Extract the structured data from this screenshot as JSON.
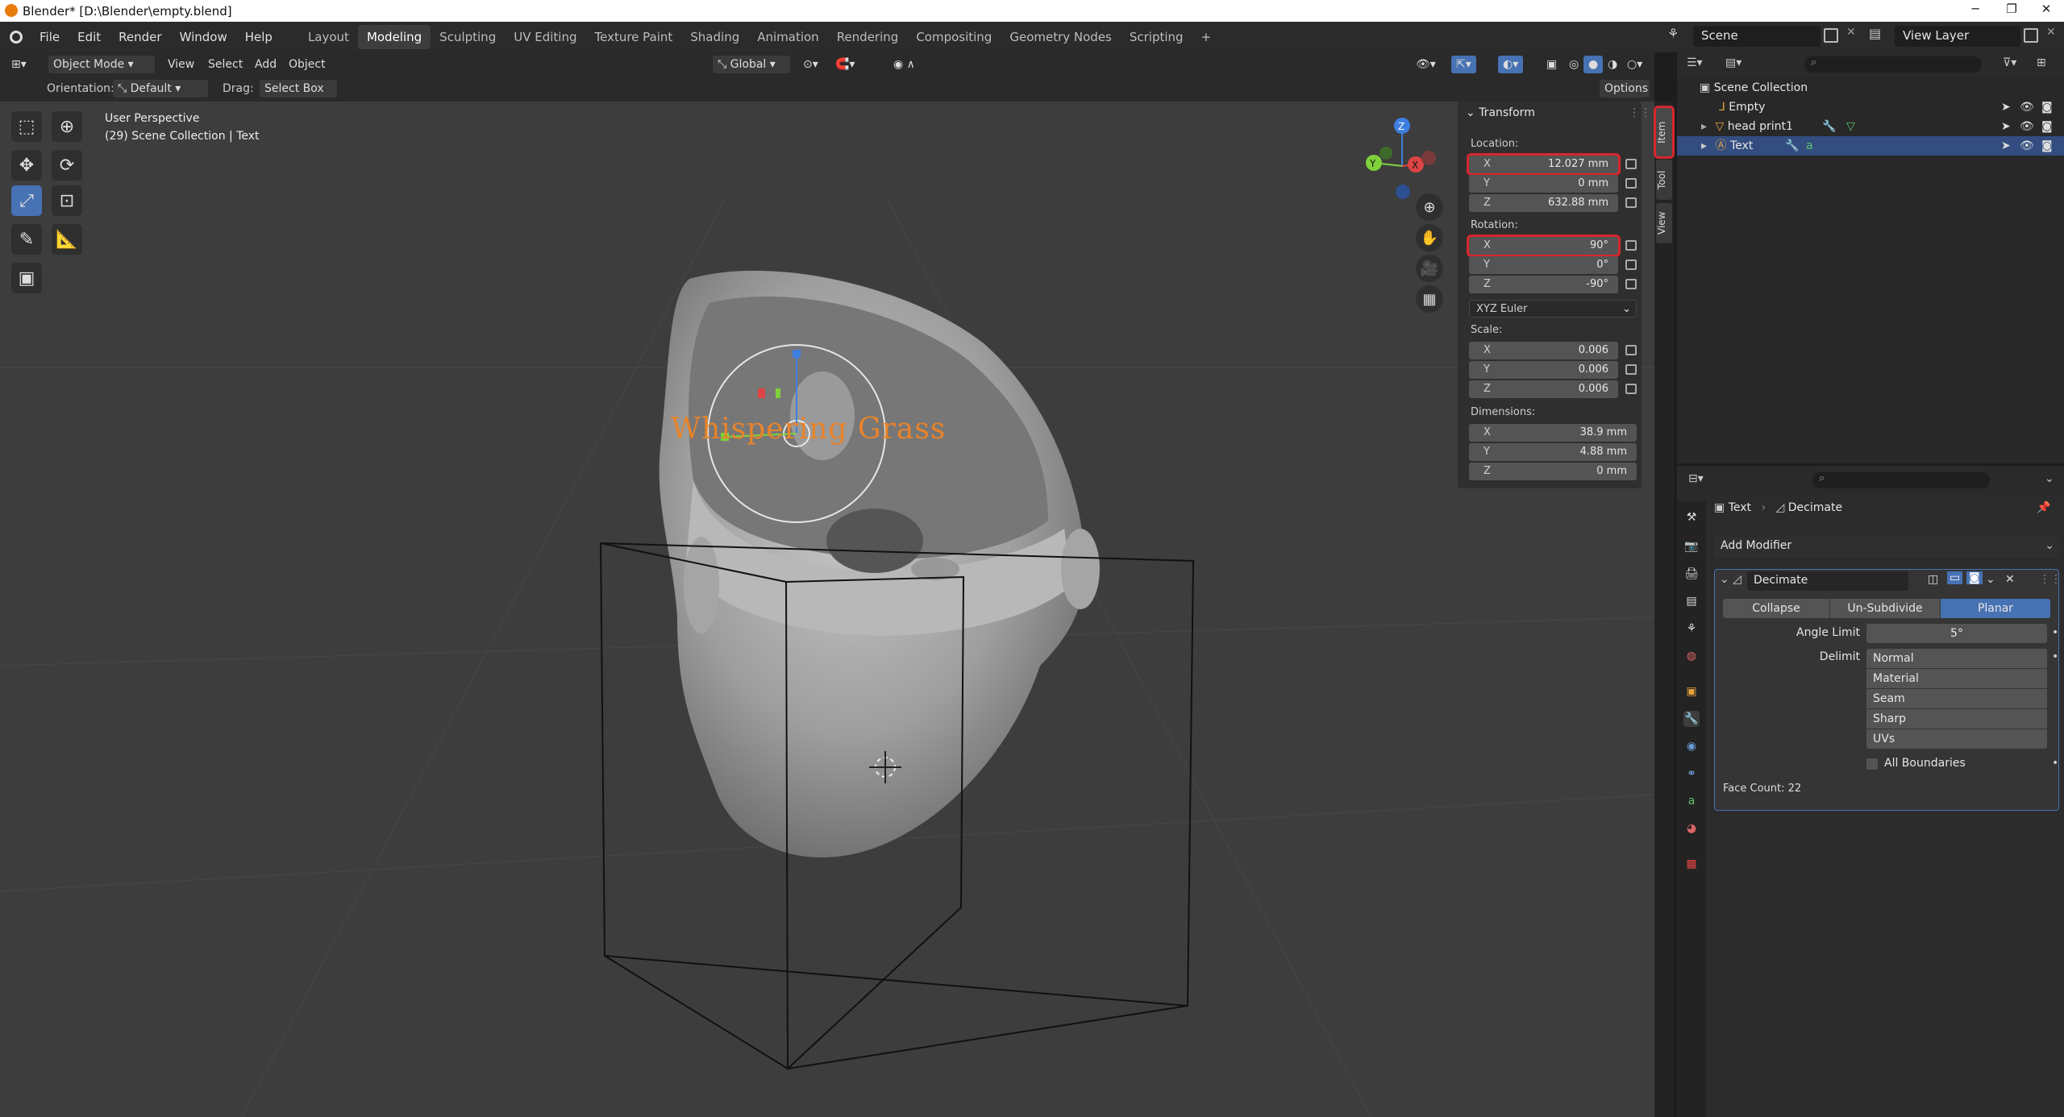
{
  "title_bar": {
    "title": "Blender* [D:\\Blender\\empty.blend]"
  },
  "menu": [
    "File",
    "Edit",
    "Render",
    "Window",
    "Help"
  ],
  "workspaces": [
    "Layout",
    "Modeling",
    "Sculpting",
    "UV Editing",
    "Texture Paint",
    "Shading",
    "Animation",
    "Rendering",
    "Compositing",
    "Geometry Nodes",
    "Scripting",
    "+"
  ],
  "active_workspace": "Modeling",
  "scene": {
    "scene_label": "Scene",
    "view_layer_label": "View Layer"
  },
  "viewport_header": {
    "mode": "Object Mode",
    "view": "View",
    "select": "Select",
    "add": "Add",
    "object": "Object",
    "transform_space": "Global",
    "orientation_label": "Orientation:",
    "orientation_value": "Default",
    "drag_label": "Drag:",
    "drag_value": "Select Box",
    "options": "Options"
  },
  "viewport_overlay": {
    "perspective": "User Perspective",
    "collection": "(29) Scene Collection | Text"
  },
  "scene_text": "Whispering Grass",
  "gizmo": {
    "x": "X",
    "y": "Y",
    "z": "Z"
  },
  "sidebar_tabs": [
    "Item",
    "Tool",
    "View"
  ],
  "transform_panel": {
    "title": "Transform",
    "location_label": "Location:",
    "location": [
      {
        "axis": "X",
        "value": "12.027 mm"
      },
      {
        "axis": "Y",
        "value": "0 mm"
      },
      {
        "axis": "Z",
        "value": "632.88 mm"
      }
    ],
    "rotation_label": "Rotation:",
    "rotation": [
      {
        "axis": "X",
        "value": "90°"
      },
      {
        "axis": "Y",
        "value": "0°"
      },
      {
        "axis": "Z",
        "value": "-90°"
      }
    ],
    "rotation_mode": "XYZ Euler",
    "scale_label": "Scale:",
    "scale": [
      {
        "axis": "X",
        "value": "0.006"
      },
      {
        "axis": "Y",
        "value": "0.006"
      },
      {
        "axis": "Z",
        "value": "0.006"
      }
    ],
    "dimensions_label": "Dimensions:",
    "dimensions": [
      {
        "axis": "X",
        "value": "38.9 mm"
      },
      {
        "axis": "Y",
        "value": "4.88 mm"
      },
      {
        "axis": "Z",
        "value": "0 mm"
      }
    ]
  },
  "outliner": {
    "root": "Scene Collection",
    "items": [
      {
        "name": "Empty",
        "selected": false
      },
      {
        "name": "head print1",
        "selected": false
      },
      {
        "name": "Text",
        "selected": true
      }
    ]
  },
  "properties": {
    "breadcrumb_object": "Text",
    "breadcrumb_modifier": "Decimate",
    "add_modifier": "Add Modifier",
    "modifier_name": "Decimate",
    "modes": [
      "Collapse",
      "Un-Subdivide",
      "Planar"
    ],
    "active_mode": "Planar",
    "angle_limit_label": "Angle Limit",
    "angle_limit": "5°",
    "delimit_label": "Delimit",
    "delimit_options": [
      "Normal",
      "Material",
      "Seam",
      "Sharp",
      "UVs"
    ],
    "all_boundaries": "All Boundaries",
    "face_count": "Face Count: 22"
  },
  "colors": {
    "accent": "#4772b3",
    "selection": "#334d80",
    "highlight": "#d8262c",
    "text_object": "#e8832a"
  }
}
